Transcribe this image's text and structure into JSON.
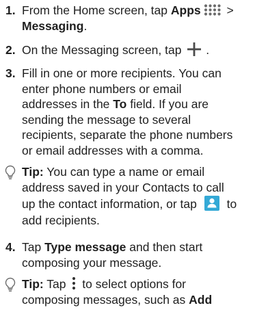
{
  "steps": [
    {
      "number": "1.",
      "line1_pre": "From the Home screen, tap ",
      "line1_bold": "Apps",
      "line1_post": " >",
      "line2_bold": "Messaging",
      "line2_post": "."
    },
    {
      "number": "2.",
      "pre": "On the Messaging screen, tap ",
      "post": " ."
    },
    {
      "number": "3.",
      "l1": "Fill in one or more recipients. You can",
      "l2": "enter phone numbers or email",
      "l3_pre": "addresses in the ",
      "l3_bold": "To",
      "l3_post": " field. If you are",
      "l4": "sending the message to several",
      "l5": "recipients, separate the phone numbers",
      "l6": "or email addresses with a comma."
    },
    {
      "number": "4.",
      "l1_pre": "Tap ",
      "l1_bold": "Type message",
      "l1_post": " and then start",
      "l2": "composing your message."
    }
  ],
  "tips": [
    {
      "label": "Tip:",
      "l1_post": " You can type a name or email",
      "l2": "address saved in your Contacts to call",
      "l3_pre": "up the contact information, or tap ",
      "l3_post": " to",
      "l4": "add recipients."
    },
    {
      "label": "Tip:",
      "l1_pre": " Tap ",
      "l1_post": " to select options for",
      "l2_pre": "composing messages, such as ",
      "l2_bold": "Add"
    }
  ],
  "icons": {
    "apps": "apps-grid-icon",
    "plus": "plus-icon",
    "contact": "contact-icon",
    "menu": "more-options-icon",
    "tip": "lightbulb-icon"
  },
  "colors": {
    "text": "#1f1f1f",
    "contact_icon_bg": "#34a9d6",
    "icon_gray": "#6b6b6b"
  }
}
